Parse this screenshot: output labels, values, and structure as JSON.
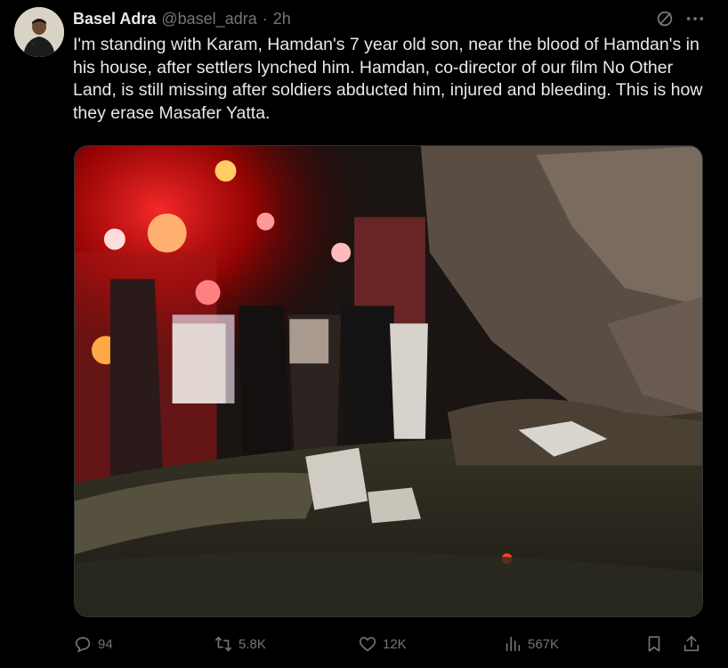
{
  "author": {
    "name": "Basel Adra",
    "handle": "@basel_adra",
    "separator": "·",
    "time": "2h"
  },
  "icons": {
    "avatar": "profile-photo",
    "grok": "grok-icon",
    "more": "more-dots-icon",
    "reply": "reply-bubble-icon",
    "repost": "repost-arrows-icon",
    "like": "heart-icon",
    "views": "bar-chart-icon",
    "bookmark": "bookmark-icon",
    "share": "share-upload-icon"
  },
  "tweet": {
    "text": "I'm standing with Karam, Hamdan's 7 year old son, near the blood of Hamdan's in his house, after settlers lynched him. Hamdan, co-director of our film No Other Land, is still missing after soldiers abducted him, injured and bleeding. This is how they erase Masafer Yatta."
  },
  "stats": {
    "replies": "94",
    "reposts": "5.8K",
    "likes": "12K",
    "views": "567K"
  },
  "colors": {
    "background": "#000000",
    "text": "#e7e9ea",
    "muted": "#71767b",
    "border": "#2f3336"
  }
}
